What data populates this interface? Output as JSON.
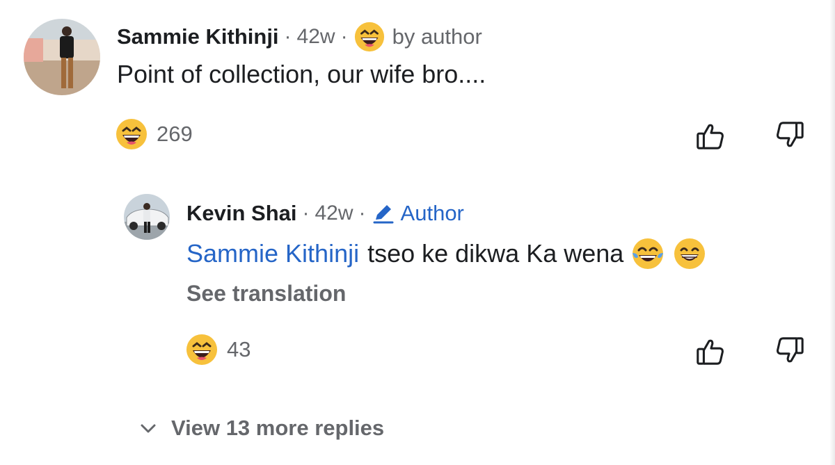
{
  "comment": {
    "author": "Sammie Kithinji",
    "time": "42w",
    "separator": "·",
    "badge_emoji": "grinning-squinting-face",
    "badge_label": "by author",
    "text": "Point of collection, our wife bro....",
    "reaction": {
      "emoji": "grinning-squinting-face",
      "count": "269"
    }
  },
  "reply": {
    "author": "Kevin Shai",
    "time": "42w",
    "separator": "·",
    "badge_icon": "pencil-icon",
    "badge_label": "Author",
    "mention": "Sammie Kithinji",
    "text": "tseo ke dikwa Ka wena",
    "trailing_emojis": [
      "face-with-tears-of-joy",
      "beaming-face-with-smiling-eyes"
    ],
    "see_translation": "See translation",
    "reaction": {
      "emoji": "grinning-squinting-face",
      "count": "43"
    }
  },
  "view_more": {
    "label": "View 13 more replies"
  },
  "colors": {
    "link_blue": "#2565c7",
    "secondary_text": "#65676b",
    "primary_text": "#1c1e21",
    "emoji_yellow": "#f7c13c"
  }
}
